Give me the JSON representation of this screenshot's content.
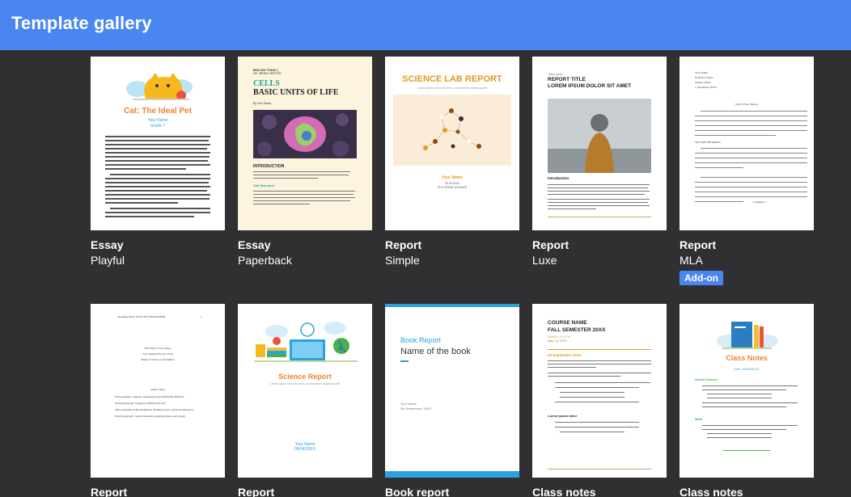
{
  "header": {
    "title": "Template gallery"
  },
  "cards": [
    {
      "category": "Essay",
      "name": "Playful",
      "thumb": {
        "title": "Cat: The Ideal Pet",
        "subtitle1": "Your Name",
        "subtitle2": "Grade 7"
      }
    },
    {
      "category": "Essay",
      "name": "Paperback",
      "thumb": {
        "kicker1": "BIOLOGY TODAY |",
        "kicker2": "DR. WENDY WRITER",
        "title1": "CELLS",
        "title2": "BASIC UNITS OF LIFE",
        "byline": "By Your Name",
        "section1": "INTRODUCTION",
        "section2": "Cell Structure"
      }
    },
    {
      "category": "Report",
      "name": "Simple",
      "thumb": {
        "title": "SCIENCE LAB REPORT",
        "subtitle": "Lorem ipsum dolor sit amet, consectetuer adipiscing elit",
        "name": "Your Name",
        "date": "09.04.20XX",
        "grade": "4TH GRADE SCIENCE"
      }
    },
    {
      "category": "Report",
      "name": "Luxe",
      "thumb": {
        "kicker": "Class name",
        "title1": "REPORT TITLE",
        "title2": "LOREM IPSUM DOLOR SIT AMET",
        "section": "Introduction"
      }
    },
    {
      "category": "Report",
      "name": "MLA",
      "badge": "Add-on",
      "thumb": {
        "line1": "Your Name",
        "line2": "Professor Name",
        "line3": "Subject Name",
        "line4": "1 September 20XX",
        "title": "Title of Your Report",
        "section": "SECTION HEADING",
        "cite": "Lastname 1"
      }
    },
    {
      "category": "Report",
      "name": "",
      "thumb": {
        "running": "Running head: TITLE OF YOUR PAPER",
        "page": "1",
        "line1": "Full Title of Your Paper",
        "line2": "Your Name (First M. Last)",
        "line3": "Name of School or Institution",
        "heading": "Author Note",
        "p1": "First paragraph: Complete departmental and institutional affiliation",
        "p2": "Second paragraph: Changes in affiliation (if any)",
        "p3": "Third paragraph: Acknowledgments, funding sources, special circumstances",
        "p4": "Fourth paragraph: Contact information (mailing address and e-mail)"
      }
    },
    {
      "category": "Report",
      "name": "",
      "thumb": {
        "title": "Science Report",
        "subtitle": "Lorem ipsum dolor sit amet, consectetuer adipiscing elit",
        "name": "Your Name",
        "date": "09/04/20XX"
      }
    },
    {
      "category": "Book report",
      "name": "",
      "thumb": {
        "label": "Book Report",
        "title": "Name of the book",
        "name": "Your Name",
        "date": "4th September, 20XX"
      }
    },
    {
      "category": "Class notes",
      "name": "",
      "thumb": {
        "title1": "COURSE NAME",
        "title2": "FALL SEMESTER 20XX",
        "sub1": "Session, 12-4 Pm",
        "sub2": "Aug. 1-4, 20XX",
        "date": "04 September 20XX",
        "heading": "Lorem ipsum dolor"
      }
    },
    {
      "category": "Class notes",
      "name": "",
      "thumb": {
        "title": "Class Notes",
        "date": "Date: 09/04/20XX",
        "section1": "Social Science",
        "section2": "Math"
      }
    }
  ]
}
